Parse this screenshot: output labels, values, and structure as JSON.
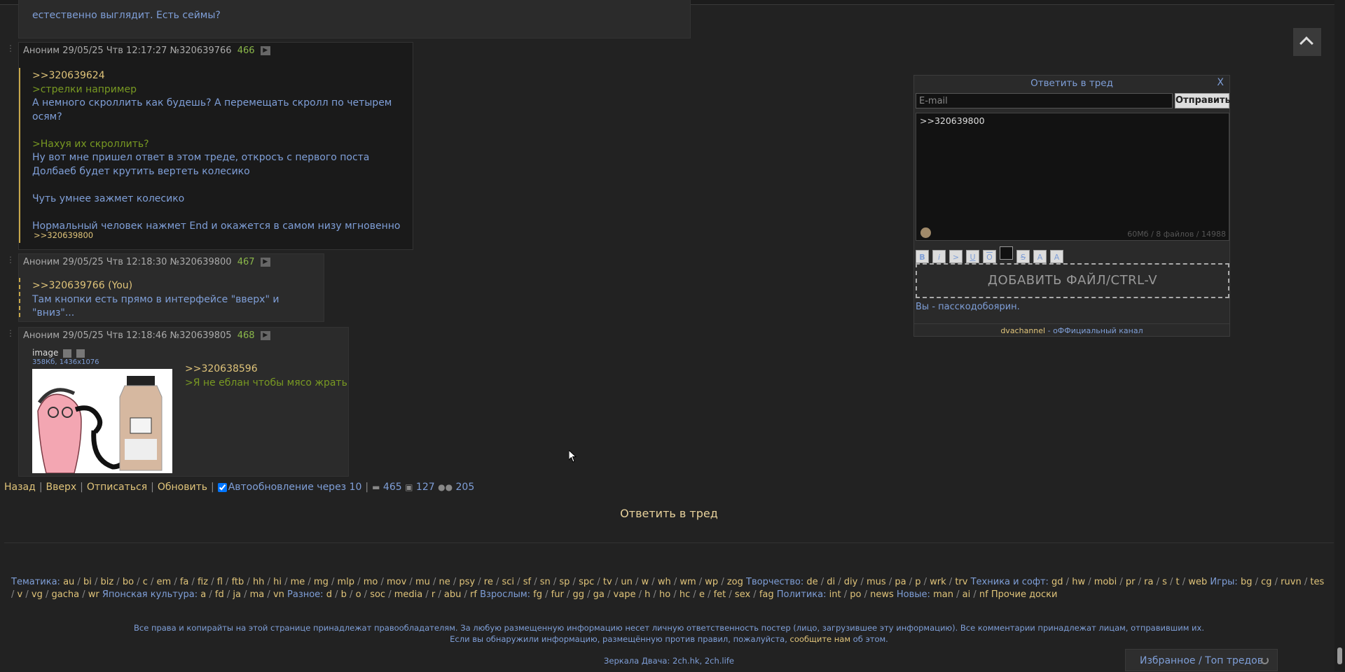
{
  "top_post": {
    "line1_partial": "естественно выглядит. Есть сеймы?"
  },
  "posts": [
    {
      "author": "Аноним",
      "date": "29/05/25 Чтв 12:17:27",
      "id": "№320639766",
      "number": "466",
      "lines": [
        {
          "text": ">>320639624",
          "kind": "ref"
        },
        {
          "text": ">стрелки например",
          "kind": "gt"
        },
        {
          "text": "А немного скроллить как будешь? А перемещать скролл по четырем осям?",
          "kind": "pl"
        },
        {
          "text": "",
          "kind": "pl"
        },
        {
          "text": ">Нахуя их скроллить?",
          "kind": "gt"
        },
        {
          "text": "Ну вот мне пришел ответ в этом треде, откросъ с первого поста",
          "kind": "pl"
        },
        {
          "text": "Долбаеб будет крутить вертеть колесико",
          "kind": "pl"
        },
        {
          "text": "",
          "kind": "pl"
        },
        {
          "text": "Чуть умнее зажмет колесико",
          "kind": "pl"
        },
        {
          "text": "",
          "kind": "pl"
        },
        {
          "text": "Нормальный человек нажмет End и окажется в самом низу мгновенно",
          "kind": "pl"
        }
      ],
      "reply_ref": ">>320639800"
    },
    {
      "author": "Аноним",
      "date": "29/05/25 Чтв 12:18:30",
      "id": "№320639800",
      "number": "467",
      "lines": [
        {
          "text": ">>320639766 (You)",
          "kind": "ref"
        },
        {
          "text": "Там кнопки есть прямо в интерфейсе \"вверх\" и \"вниз\"...",
          "kind": "pl"
        }
      ]
    },
    {
      "author": "Аноним",
      "date": "29/05/25 Чтв 12:18:46",
      "id": "№320639805",
      "number": "468",
      "image_name": "image",
      "image_meta": "358Кб, 1436x1076",
      "lines": [
        {
          "text": ">>320638596",
          "kind": "ref"
        },
        {
          "text": ">Я не еблан чтобы мясо жрать",
          "kind": "gt"
        }
      ]
    }
  ],
  "nav": {
    "back": "Назад",
    "up": "Вверх",
    "unsubscribe": "Отписаться",
    "refresh": "Обновить",
    "autoupdate": "Автообновление через 10",
    "posts_count": "465",
    "files_count": "127",
    "users_count": "205"
  },
  "reply_in_thread": "Ответить в тред",
  "boards_html_parts": {
    "line1": [
      {
        "cat": "Тематика:",
        "boards": [
          "au",
          "bi",
          "biz",
          "bo",
          "c",
          "em",
          "fa",
          "fiz",
          "fl",
          "ftb",
          "hh",
          "hi",
          "me",
          "mg",
          "mlp",
          "mo",
          "mov",
          "mu",
          "ne",
          "psy",
          "re",
          "sci",
          "sf",
          "sn",
          "sp",
          "spc",
          "tv",
          "un",
          "w",
          "wh",
          "wm",
          "wp",
          "zog"
        ]
      },
      {
        "cat": "Творчество:",
        "boards": [
          "de",
          "di",
          "diy",
          "mus",
          "pa",
          "p",
          "wrk",
          "trv"
        ]
      },
      {
        "cat": "Техника и софт:",
        "boards": [
          "gd",
          "hw",
          "mobi",
          "pr",
          "ra",
          "s",
          "t",
          "web"
        ]
      },
      {
        "cat": "Игры:",
        "boards": [
          "bg",
          "cg",
          "ruvn"
        ]
      }
    ],
    "line2_lead": [
      "tes",
      "v",
      "vg",
      "gacha",
      "wr"
    ],
    "line2": [
      {
        "cat": "Японская культура:",
        "boards": [
          "a",
          "fd",
          "ja",
          "ma",
          "vn"
        ]
      },
      {
        "cat": "Разное:",
        "boards": [
          "d",
          "b",
          "o",
          "soc",
          "media",
          "r",
          "abu",
          "rf"
        ]
      },
      {
        "cat": "Взрослым:",
        "boards": [
          "fg",
          "fur",
          "gg",
          "ga",
          "vape",
          "h",
          "ho",
          "hc",
          "e",
          "fet",
          "sex",
          "fag"
        ]
      },
      {
        "cat": "Политика:",
        "boards": [
          "int",
          "po",
          "news"
        ]
      },
      {
        "cat": "Новые:",
        "boards": [
          "man",
          "ai",
          "nf"
        ]
      }
    ],
    "other": "Прочие доски"
  },
  "copyright": {
    "line1": "Все права и копирайты на этой странице принадлежат правообладателям. За любую размещенную информацию несет личную ответственность постер (лицо, загрузившее эту информацию). Все комментарии принадлежат лицам, отправившим их.",
    "line2_a": "Если вы обнаружили информацию, размещённую против правил, пожалуйста,",
    "line2_link": "сообщите нам",
    "line2_b": "об этом."
  },
  "mirrors": "Зеркала Двача: 2ch.hk, 2ch.life",
  "form": {
    "title": "Ответить в тред",
    "close": "X",
    "email_placeholder": "E-mail",
    "send": "Отправить",
    "text": ">>320639800",
    "limits": "60Мб / 8 файлов / 14988",
    "markup": [
      "B",
      "i",
      ">",
      "U",
      "O",
      "",
      "S",
      "A",
      "A"
    ],
    "add_file": "ДОБАВИТЬ ФАЙЛ/CTRL-V",
    "passcode": "Вы - пасскодобоярин.",
    "footer_a": "dvachannel",
    "footer_sep": " - ",
    "footer_b": "оФФициальный канал"
  },
  "favorites": "Избранное / Топ тредов"
}
